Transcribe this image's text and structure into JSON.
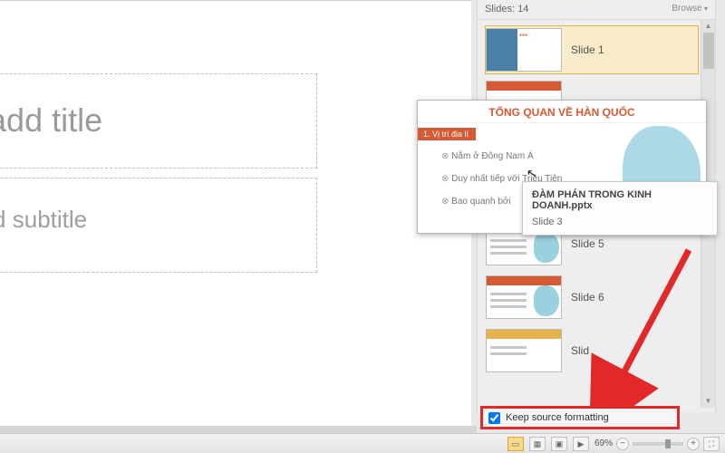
{
  "editor": {
    "title_placeholder": "ck to add title",
    "subtitle_placeholder": "ck to add subtitle"
  },
  "panel": {
    "header": "Slides: 14",
    "browse": "Browse",
    "items": [
      {
        "label": "Slide 1"
      },
      {
        "label": ""
      },
      {
        "label": ""
      },
      {
        "label": ""
      },
      {
        "label": "Slide 5"
      },
      {
        "label": "Slide 6"
      },
      {
        "label": "Slid"
      }
    ]
  },
  "drag_preview": {
    "title": "TỔNG QUAN VỀ HÀN QUỐC",
    "badge": "1. Vị trí địa lí",
    "b1": "Nằm ở Đông Nam Á",
    "b2": "Duy nhất tiếp với Triều Tiên",
    "b3": "Bao quanh bởi"
  },
  "tooltip": {
    "file": "ĐÀM PHÁN TRONG KINH DOANH.pptx",
    "sub": "Slide 3"
  },
  "keep_fmt": {
    "label": "Keep source formatting"
  },
  "status": {
    "zoom": "69%"
  }
}
